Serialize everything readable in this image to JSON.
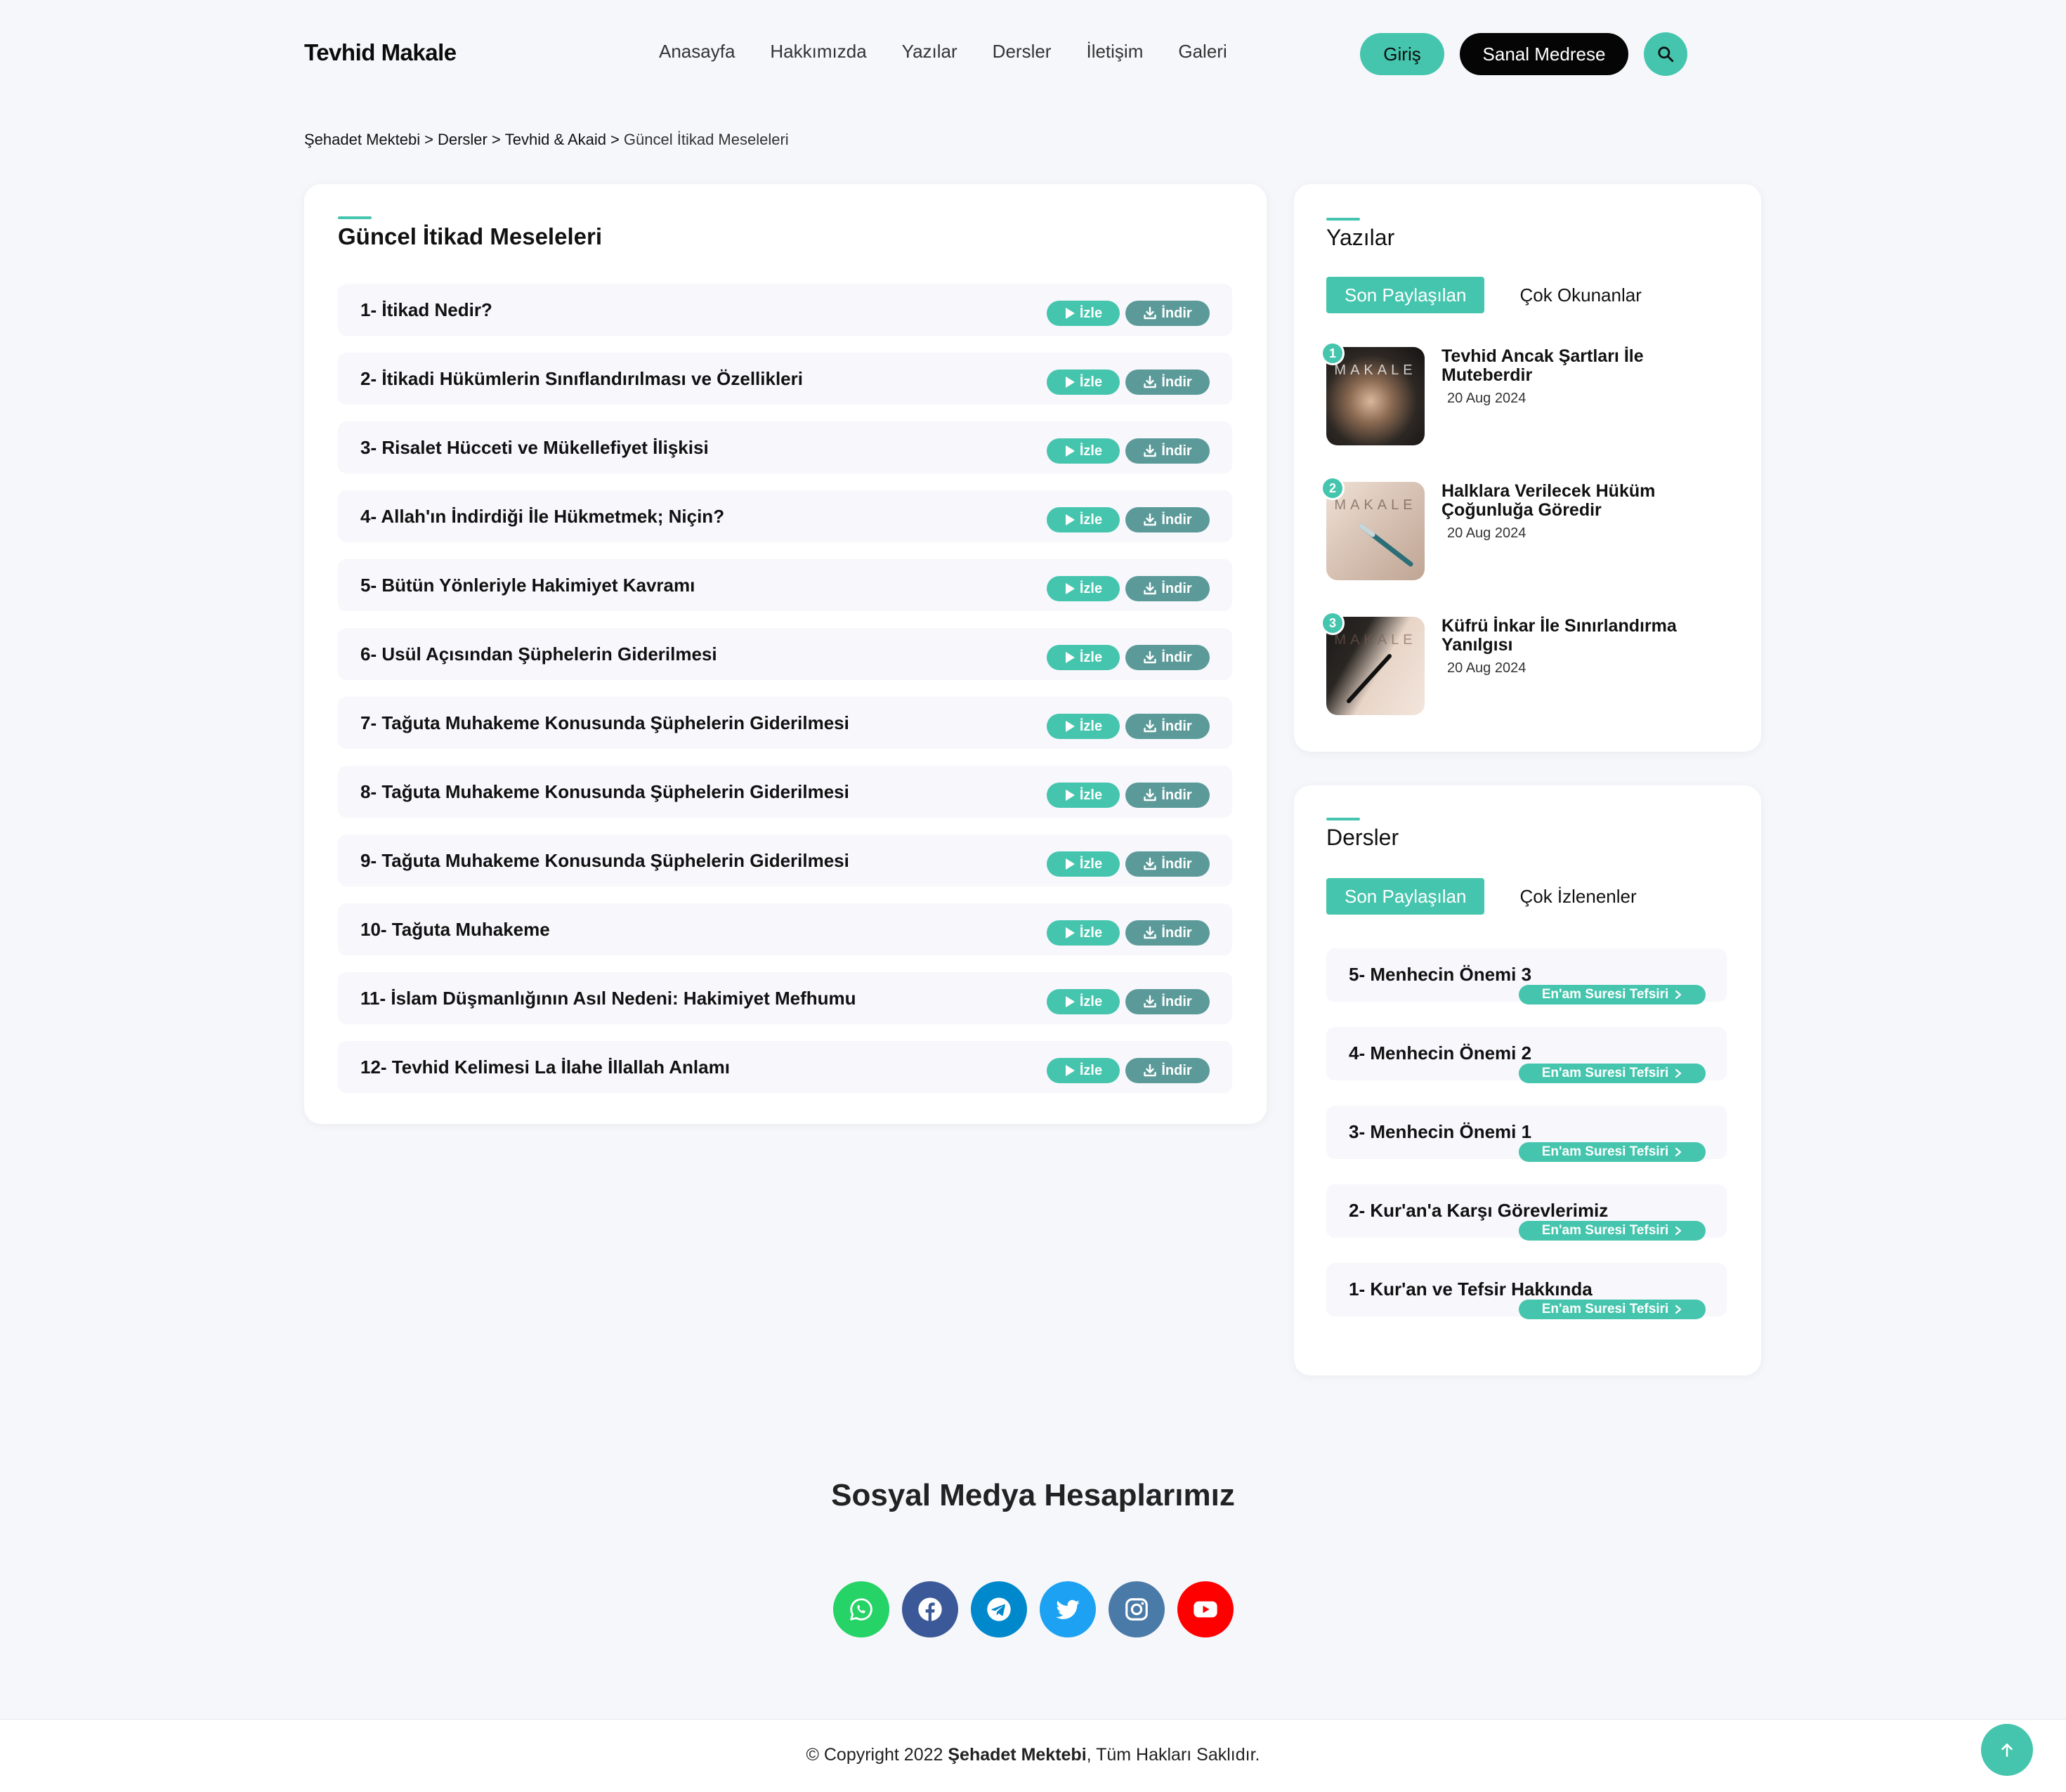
{
  "header": {
    "logo": "Tevhid Makale",
    "nav": [
      "Anasayfa",
      "Hakkımızda",
      "Yazılar",
      "Dersler",
      "İletişim",
      "Galeri"
    ],
    "login_label": "Giriş",
    "medrese_label": "Sanal Medrese",
    "search_icon": "search-icon"
  },
  "breadcrumb": {
    "items": [
      "Şehadet Mektebi",
      "Dersler",
      "Tevhid & Akaid"
    ],
    "separator": ">",
    "current": "Güncel İtikad Meseleleri"
  },
  "main": {
    "title": "Güncel İtikad Meseleleri",
    "watch_label": "İzle",
    "download_label": "İndir",
    "lessons": [
      "1- İtikad Nedir?",
      "2- İtikadi Hükümlerin Sınıflandırılması ve Özellikleri",
      "3- Risalet Hücceti ve Mükellefiyet İlişkisi",
      "4- Allah'ın İndirdiği İle Hükmetmek; Niçin?",
      "5- Bütün Yönleriyle Hakimiyet Kavramı",
      "6- Usül Açısından Şüphelerin Giderilmesi",
      "7- Tağuta Muhakeme Konusunda Şüphelerin Giderilmesi",
      "8- Tağuta Muhakeme Konusunda Şüphelerin Giderilmesi",
      "9- Tağuta Muhakeme Konusunda Şüphelerin Giderilmesi",
      "10- Tağuta Muhakeme",
      "11- İslam Düşmanlığının Asıl Nedeni: Hakimiyet Mefhumu",
      "12- Tevhid Kelimesi La İlahe İllallah Anlamı"
    ]
  },
  "yazilar": {
    "title": "Yazılar",
    "tab_active": "Son Paylaşılan",
    "tab_other": "Çok Okunanlar",
    "posts": [
      {
        "num": "1",
        "title": "Tevhid Ancak Şartları İle Muteberdir",
        "date": "20 Aug 2024",
        "thumb_text": "MAKALE"
      },
      {
        "num": "2",
        "title": "Halklara Verilecek Hüküm Çoğunluğa Göredir",
        "date": "20 Aug 2024",
        "thumb_text": "MAKALE"
      },
      {
        "num": "3",
        "title": "Küfrü İnkar İle Sınırlandırma Yanılgısı",
        "date": "20 Aug 2024",
        "thumb_text": "MAKALE"
      }
    ]
  },
  "dersler": {
    "title": "Dersler",
    "tab_active": "Son Paylaşılan",
    "tab_other": "Çok İzlenenler",
    "items": [
      {
        "title": "5- Menhecin Önemi 3",
        "tag": "En'am Suresi Tefsiri"
      },
      {
        "title": "4- Menhecin Önemi 2",
        "tag": "En'am Suresi Tefsiri"
      },
      {
        "title": "3- Menhecin Önemi 1",
        "tag": "En'am Suresi Tefsiri"
      },
      {
        "title": "2- Kur'an'a Karşı Görevlerimiz",
        "tag": "En'am Suresi Tefsiri"
      },
      {
        "title": "1- Kur'an ve Tefsir Hakkında",
        "tag": "En'am Suresi Tefsiri"
      }
    ]
  },
  "social": {
    "title": "Sosyal Medya Hesaplarımız",
    "icons": [
      {
        "name": "whatsapp-icon",
        "color": "#25d366"
      },
      {
        "name": "facebook-icon",
        "color": "#3b5998"
      },
      {
        "name": "telegram-icon",
        "color": "#0088cc"
      },
      {
        "name": "twitter-icon",
        "color": "#1da1f2"
      },
      {
        "name": "instagram-icon",
        "color": "#4a7aa8"
      },
      {
        "name": "youtube-icon",
        "color": "#ff0000"
      }
    ]
  },
  "footer": {
    "prefix": "© Copyright 2022",
    "brand": "Şehadet Mektebi",
    "suffix": ", Tüm Hakları Saklıdır."
  },
  "colors": {
    "accent": "#45c5ad",
    "download": "#5b9a99",
    "background": "#f6f7fb"
  }
}
